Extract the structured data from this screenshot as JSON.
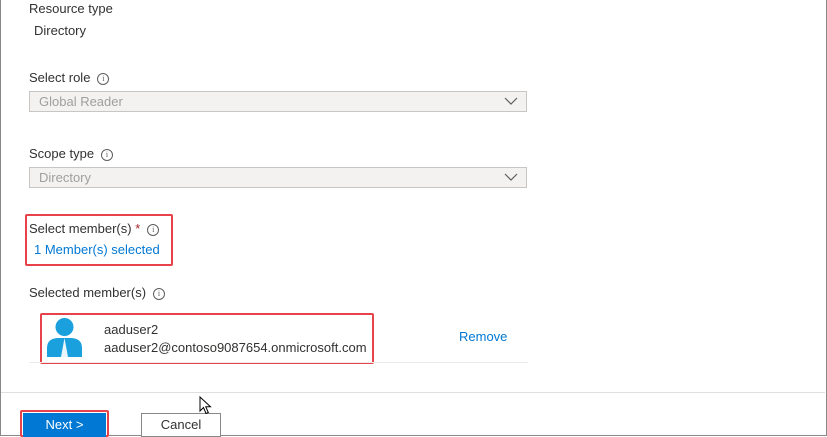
{
  "resource_type": {
    "label": "Resource type",
    "value": "Directory"
  },
  "select_role": {
    "label": "Select role",
    "value": "Global Reader"
  },
  "scope_type": {
    "label": "Scope type",
    "value": "Directory"
  },
  "select_members": {
    "label": "Select member(s)",
    "required_mark": "*",
    "link_text": "1 Member(s) selected"
  },
  "selected_members": {
    "label": "Selected member(s)",
    "items": [
      {
        "name": "aaduser2",
        "email": "aaduser2@contoso9087654.onmicrosoft.com",
        "remove_label": "Remove"
      }
    ]
  },
  "footer": {
    "next_label": "Next >",
    "cancel_label": "Cancel"
  },
  "colors": {
    "accent": "#0078d4",
    "highlight": "#e8434a",
    "avatar": "#1aa0dc"
  },
  "icons": [
    "info-icon",
    "chevron-down-icon",
    "user-avatar-icon",
    "mouse-cursor-icon"
  ]
}
